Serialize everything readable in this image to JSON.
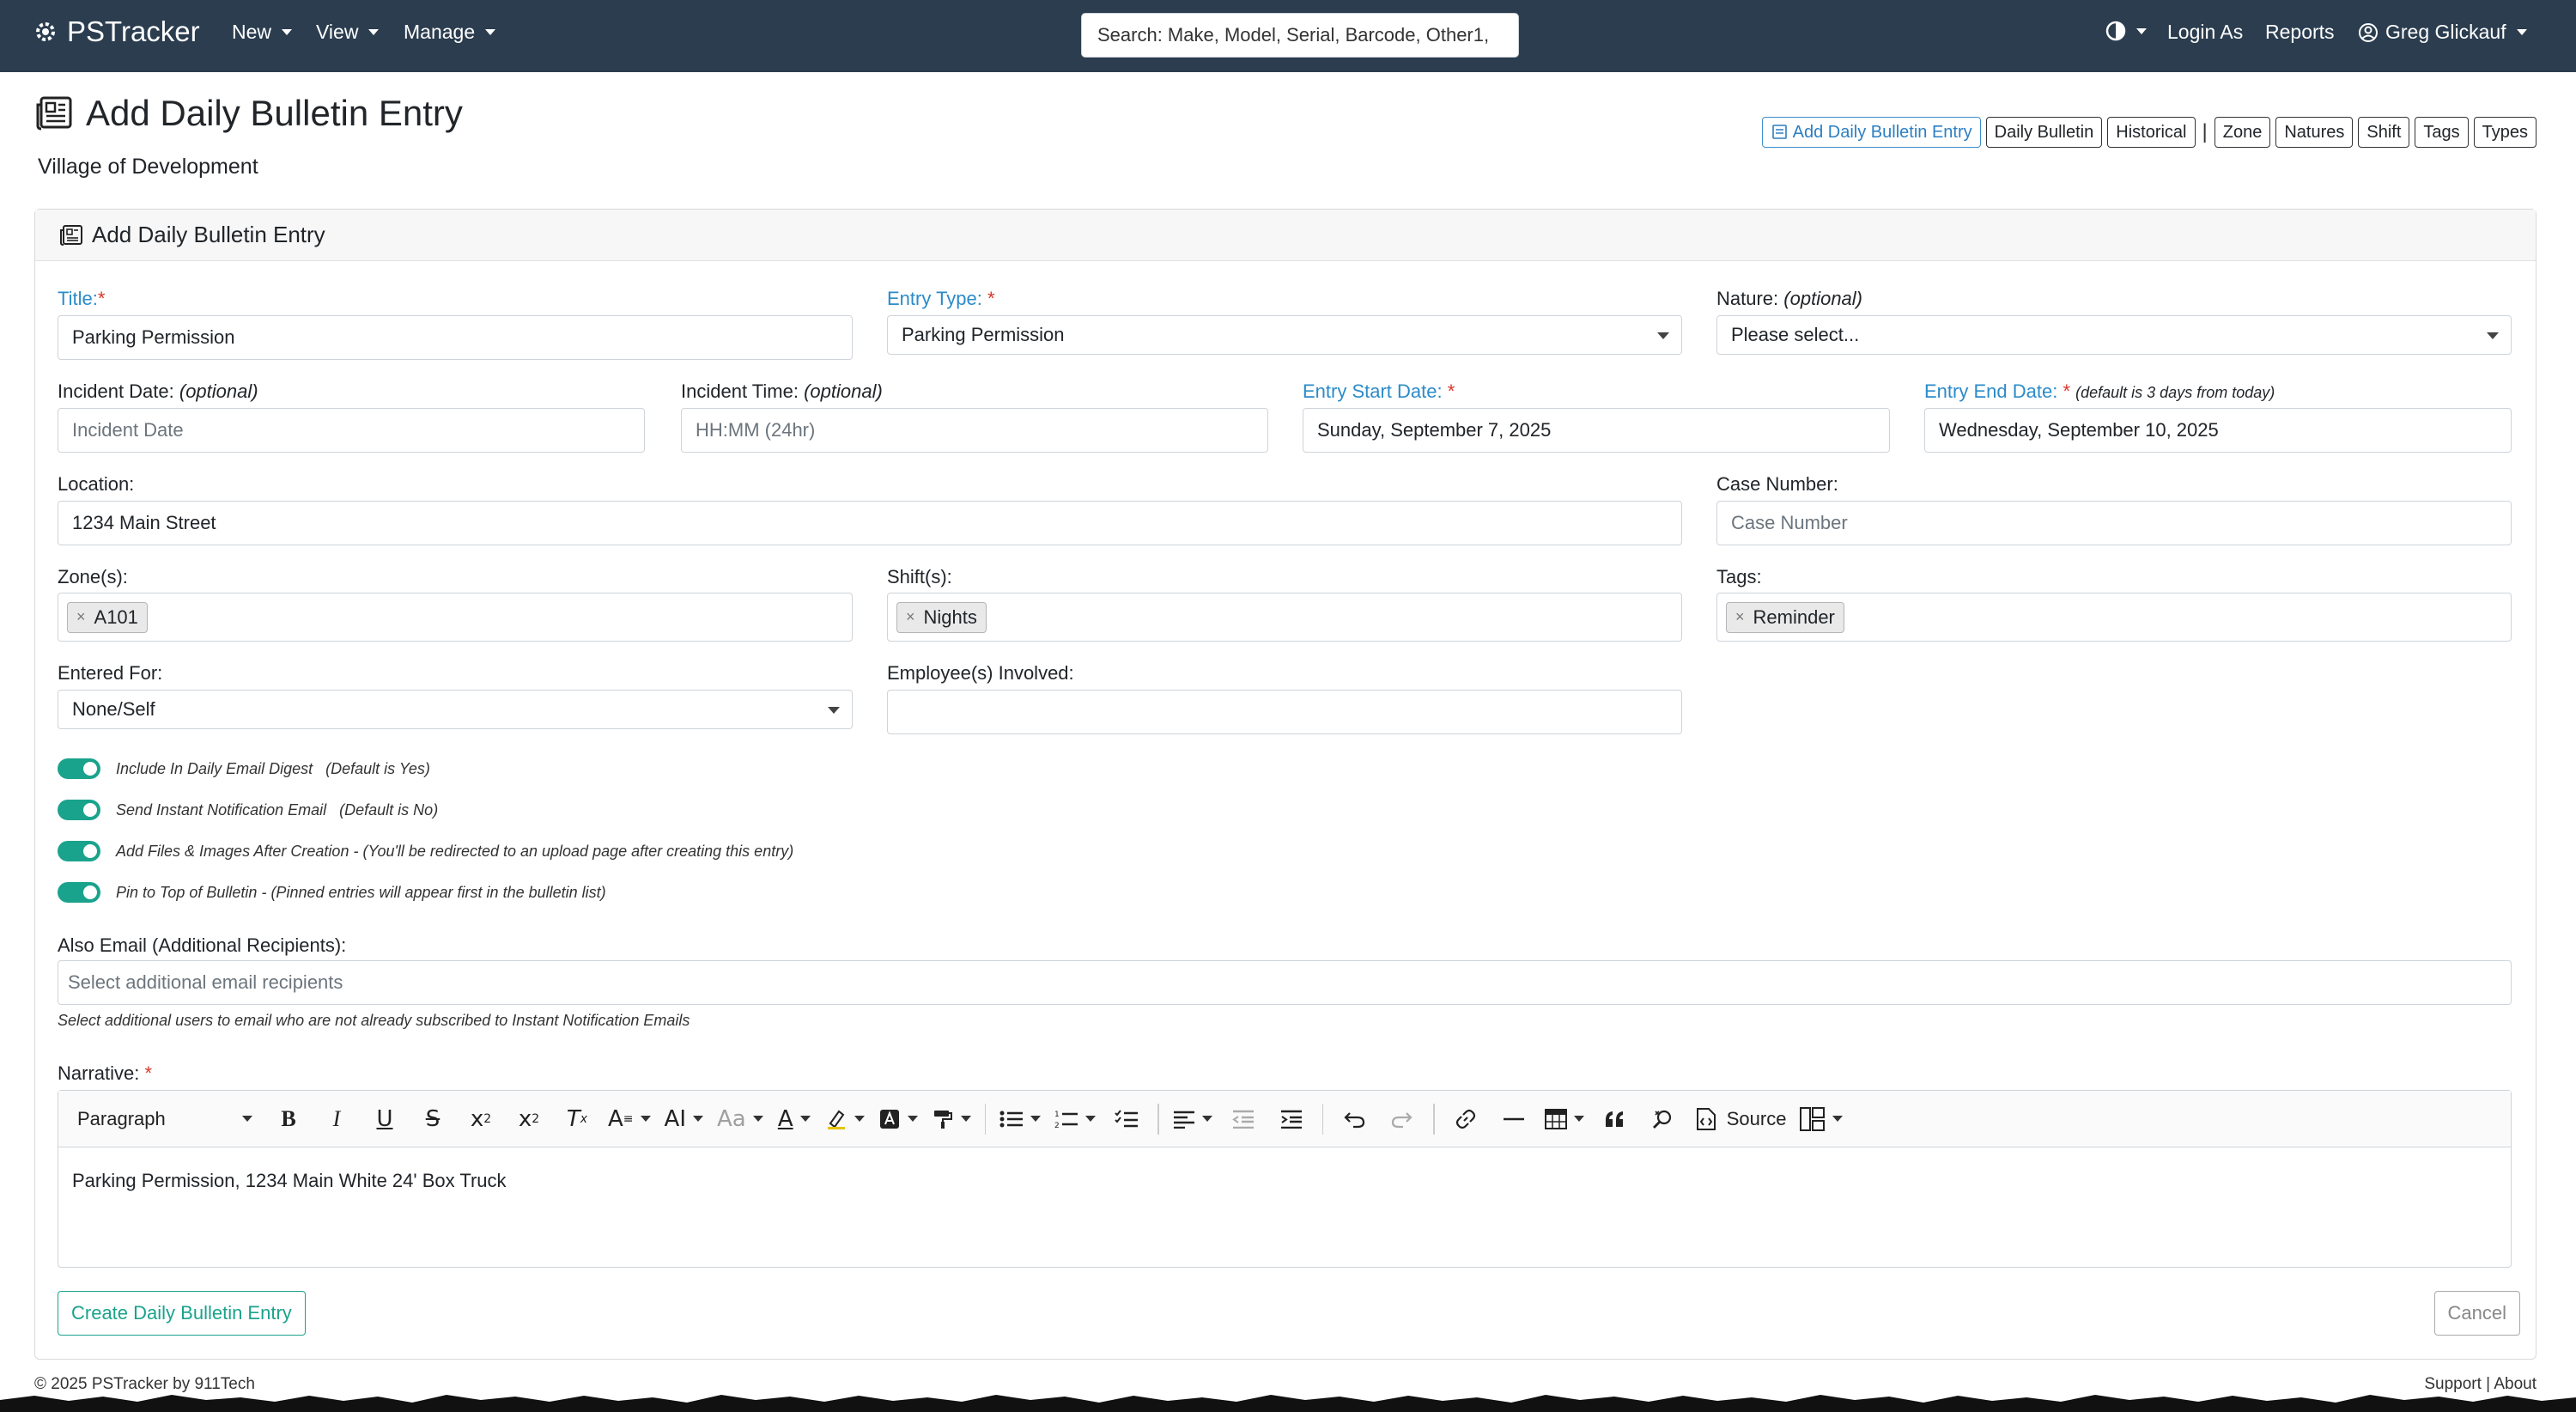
{
  "navbar": {
    "brand": "PSTracker",
    "menus": [
      "New",
      "View",
      "Manage"
    ],
    "search_placeholder": "Search: Make, Model, Serial, Barcode, Other1,",
    "login_as": "Login As",
    "reports": "Reports",
    "user": "Greg Glickauf"
  },
  "page": {
    "title": "Add Daily Bulletin Entry",
    "subtitle": "Village of Development"
  },
  "toolbar": {
    "add_entry": "Add Daily Bulletin Entry",
    "daily_bulletin": "Daily Bulletin",
    "historical": "Historical",
    "separator": "|",
    "zone": "Zone",
    "natures": "Natures",
    "shift": "Shift",
    "tags": "Tags",
    "types": "Types"
  },
  "card": {
    "header": "Add Daily Bulletin Entry"
  },
  "form": {
    "title": {
      "label": "Title:",
      "required": "*",
      "value": "Parking Permission"
    },
    "entry_type": {
      "label": "Entry Type:",
      "required": "*",
      "value": "Parking Permission"
    },
    "nature": {
      "label": "Nature:",
      "note": "(optional)",
      "value": "Please select..."
    },
    "incident_date": {
      "label": "Incident Date:",
      "note": "(optional)",
      "placeholder": "Incident Date"
    },
    "incident_time": {
      "label": "Incident Time:",
      "note": "(optional)",
      "placeholder": "HH:MM (24hr)"
    },
    "entry_start": {
      "label": "Entry Start Date:",
      "required": "*",
      "value": "Sunday, September 7, 2025"
    },
    "entry_end": {
      "label": "Entry End Date:",
      "required": "*",
      "note": "(default is 3 days from today)",
      "value": "Wednesday, September 10, 2025"
    },
    "location": {
      "label": "Location:",
      "value": "1234 Main Street"
    },
    "case_number": {
      "label": "Case Number:",
      "placeholder": "Case Number"
    },
    "zones": {
      "label": "Zone(s):",
      "chip": "A101"
    },
    "shifts": {
      "label": "Shift(s):",
      "chip": "Nights"
    },
    "tags": {
      "label": "Tags:",
      "chip": "Reminder"
    },
    "chip_remove": "×",
    "entered_for": {
      "label": "Entered For:",
      "value": "None/Self"
    },
    "employees": {
      "label": "Employee(s) Involved:"
    },
    "toggles": [
      {
        "label": "Include In Daily Email Digest",
        "note": "(Default is Yes)"
      },
      {
        "label": "Send Instant Notification Email",
        "note": "(Default is No)"
      },
      {
        "label": "Add Files & Images After Creation - (You'll be redirected to an upload page after creating this entry)",
        "note": ""
      },
      {
        "label": "Pin to Top of Bulletin - (Pinned entries will appear first in the bulletin list)",
        "note": ""
      }
    ],
    "also_email": {
      "label": "Also Email (Additional Recipients):",
      "placeholder": "Select additional email recipients",
      "help": "Select additional users to email who are not already subscribed to Instant Notification Emails"
    },
    "narrative": {
      "label": "Narrative:",
      "required": "*",
      "paragraph_style": "Paragraph",
      "source_label": "Source",
      "body": "Parking Permission, 1234 Main White 24' Box Truck"
    }
  },
  "actions": {
    "create": "Create Daily Bulletin Entry",
    "cancel": "Cancel"
  },
  "footer": {
    "copyright": "© 2025  PSTracker by 911Tech",
    "support": "Support",
    "sep": "|",
    "about": "About"
  },
  "colors": {
    "navbar": "#2b3d4f",
    "accent_blue": "#2b8bc9",
    "toggle_green": "#1aa38c",
    "required_red": "#d9362b"
  }
}
